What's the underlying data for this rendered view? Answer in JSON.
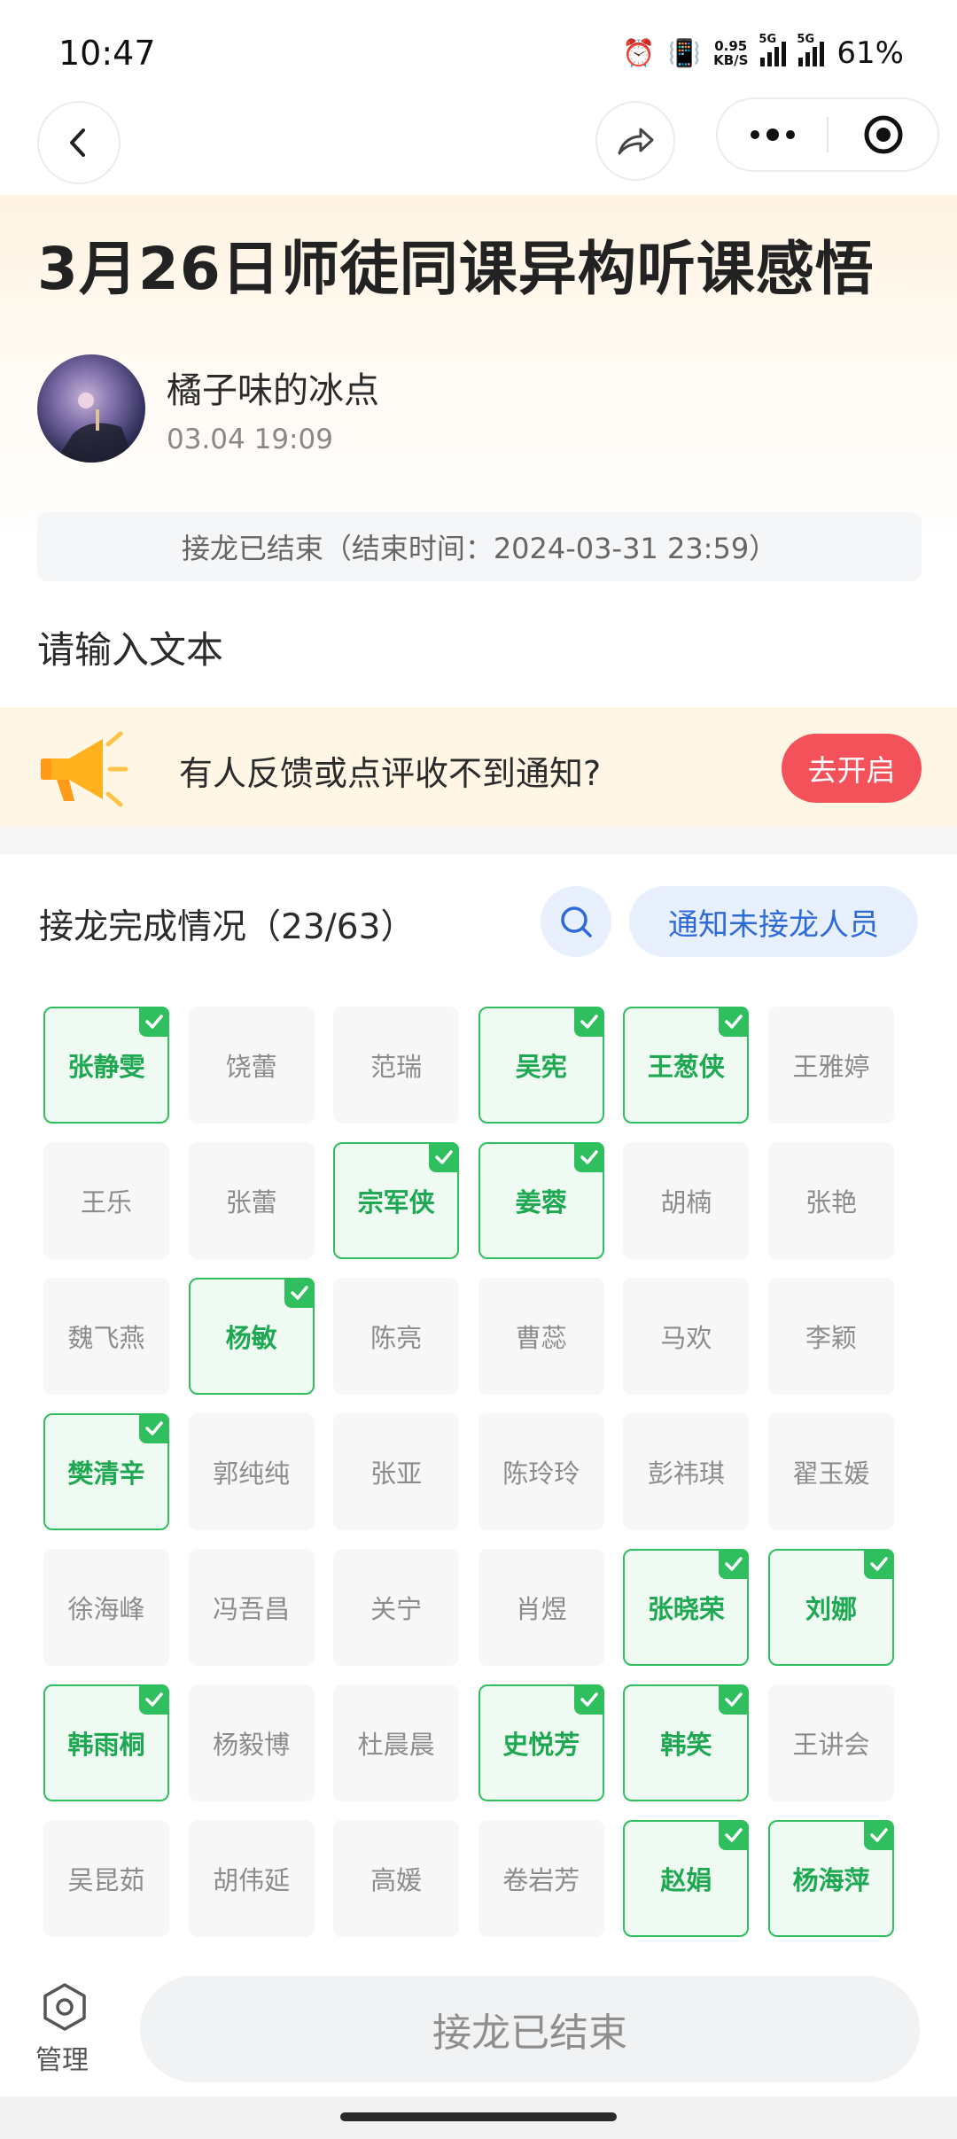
{
  "status_bar": {
    "time": "10:47",
    "net_speed_value": "0.95",
    "net_speed_unit": "KB/S",
    "sim1": "5G",
    "sim2": "5G",
    "battery": "61%"
  },
  "nav": {
    "back_icon": "chevron-left-icon",
    "share_icon": "share-arrow-icon",
    "more_icon": "more-dots-icon",
    "close_icon": "target-circle-icon"
  },
  "post": {
    "title": "3月26日师徒同课异构听课感悟",
    "author": "橘子味的冰点",
    "time": "03.04 19:09",
    "status_banner": "接龙已结束（结束时间：2024-03-31 23:59）",
    "body": "请输入文本"
  },
  "notify_strip": {
    "text": "有人反馈或点评收不到通知?",
    "button": "去开启"
  },
  "progress": {
    "title": "接龙完成情况（23/63）",
    "notify_button": "通知未接龙人员"
  },
  "members": [
    {
      "name": "张静雯",
      "done": true
    },
    {
      "name": "饶蕾",
      "done": false
    },
    {
      "name": "范瑞",
      "done": false
    },
    {
      "name": "吴宪",
      "done": true
    },
    {
      "name": "王葱侠",
      "done": true
    },
    {
      "name": "王雅婷",
      "done": false
    },
    {
      "name": "王乐",
      "done": false
    },
    {
      "name": "张蕾",
      "done": false
    },
    {
      "name": "宗军侠",
      "done": true
    },
    {
      "name": "姜蓉",
      "done": true
    },
    {
      "name": "胡楠",
      "done": false
    },
    {
      "name": "张艳",
      "done": false
    },
    {
      "name": "魏飞燕",
      "done": false
    },
    {
      "name": "杨敏",
      "done": true
    },
    {
      "name": "陈亮",
      "done": false
    },
    {
      "name": "曹蕊",
      "done": false
    },
    {
      "name": "马欢",
      "done": false
    },
    {
      "name": "李颖",
      "done": false
    },
    {
      "name": "樊清辛",
      "done": true
    },
    {
      "name": "郭纯纯",
      "done": false
    },
    {
      "name": "张亚",
      "done": false
    },
    {
      "name": "陈玲玲",
      "done": false
    },
    {
      "name": "彭祎琪",
      "done": false
    },
    {
      "name": "翟玉媛",
      "done": false
    },
    {
      "name": "徐海峰",
      "done": false
    },
    {
      "name": "冯吾昌",
      "done": false
    },
    {
      "name": "关宁",
      "done": false
    },
    {
      "name": "肖煜",
      "done": false
    },
    {
      "name": "张晓荣",
      "done": true
    },
    {
      "name": "刘娜",
      "done": true
    },
    {
      "name": "韩雨桐",
      "done": true
    },
    {
      "name": "杨毅博",
      "done": false
    },
    {
      "name": "杜晨晨",
      "done": false
    },
    {
      "name": "史悦芳",
      "done": true
    },
    {
      "name": "韩笑",
      "done": true
    },
    {
      "name": "王讲会",
      "done": false
    },
    {
      "name": "吴昆茹",
      "done": false
    },
    {
      "name": "胡伟延",
      "done": false
    },
    {
      "name": "高媛",
      "done": false
    },
    {
      "name": "卷岩芳",
      "done": false
    },
    {
      "name": "赵娟",
      "done": true
    },
    {
      "name": "杨海萍",
      "done": true
    }
  ],
  "bottom": {
    "manage_label": "管理",
    "closed_button": "接龙已结束"
  },
  "colors": {
    "accent_green": "#2fbf5e",
    "accent_blue": "#2f6bd8",
    "alert_red": "#f3525a"
  }
}
